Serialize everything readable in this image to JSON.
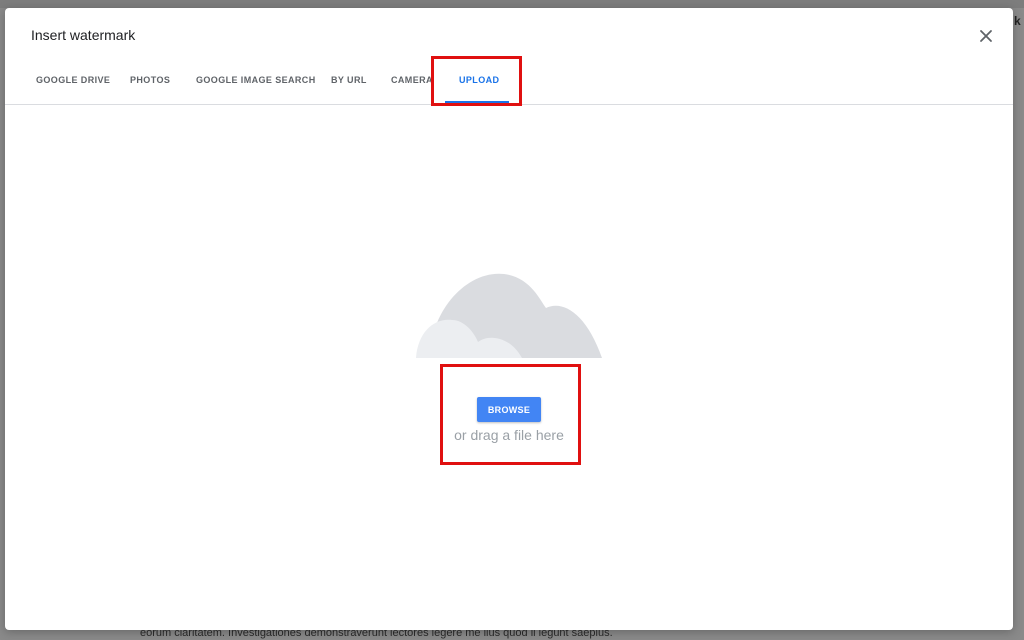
{
  "background": {
    "edge_glyph": "k",
    "footer_text": "eorum claritatem. Investigationes demonstraverunt lectores legere me lius quod ii legunt saepius."
  },
  "dialog": {
    "title": "Insert watermark",
    "close_icon": "close-icon",
    "tabs": [
      {
        "label": "GOOGLE DRIVE",
        "active": false
      },
      {
        "label": "PHOTOS",
        "active": false
      },
      {
        "label": "GOOGLE IMAGE SEARCH",
        "active": false
      },
      {
        "label": "BY URL",
        "active": false
      },
      {
        "label": "CAMERA",
        "active": false
      },
      {
        "label": "UPLOAD",
        "active": true
      }
    ],
    "upload": {
      "illustration_icon": "cloud-upload-icon",
      "browse_label": "BROWSE",
      "drag_text": "or drag a file here"
    }
  },
  "colors": {
    "accent": "#1a73e8",
    "button": "#4285f4",
    "highlight": "#e01010"
  }
}
